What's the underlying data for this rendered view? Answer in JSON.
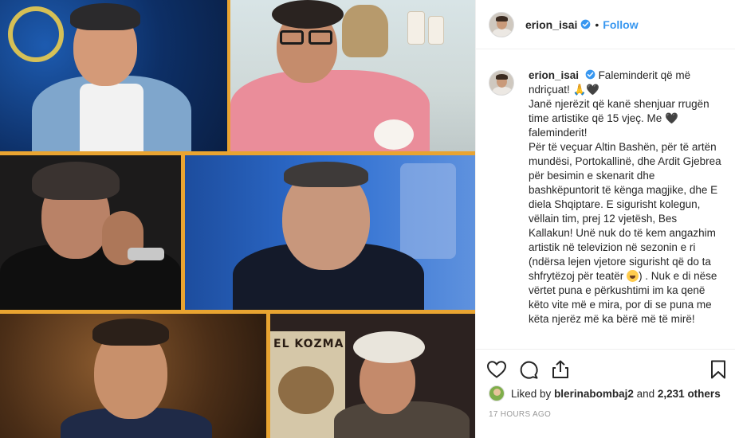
{
  "collage": {
    "poster_text": "EL KOZMA"
  },
  "header": {
    "username": "erion_isai",
    "separator": "•",
    "follow_label": "Follow"
  },
  "caption": {
    "username": "erion_isai",
    "line1": "Faleminderit që më ndriçuat! 🙏🖤",
    "line2": "Janë njerëzit që kanë shenjuar rrugën time artistike që 15 vjeç. Me 🖤 faleminderit!",
    "line3a": "Për të veçuar Altin Bashën, për të artën mundësi, Portokallinë, dhe Ardit Gjebrea për besimin e skenarit dhe bashkëpuntorit të kënga magjike, dhe E diela Shqiptare. E sigurisht kolegun, vëllain tim, prej 12 vjetësh, Bes Kallakun! Unë nuk do të kem angazhim artistik në televizion në sezonin e ri (ndërsa lejen vjetore sigurisht që do ta shfrytëzoj për teatër ",
    "line3b": ") . Nuk e di nëse vërtet puna e përkushtimi im ka qenë këto vite më e mira, por di se puna me këta njerëz më ka bërë më të mirë!"
  },
  "likes": {
    "prefix": "Liked by",
    "user": "blerinabombaj2",
    "middle": "and",
    "count": "2,231 others"
  },
  "timestamp": "17 HOURS AGO",
  "colors": {
    "accent": "#3897f0",
    "verified": "#3897f0",
    "collage_border": "#e9a431"
  }
}
